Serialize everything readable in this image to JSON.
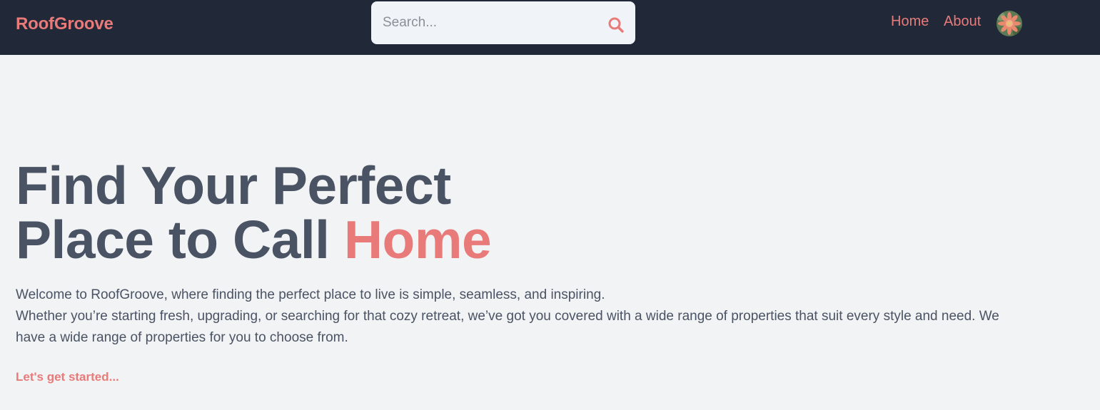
{
  "header": {
    "brand": "RoofGroove",
    "search": {
      "placeholder": "Search...",
      "value": "",
      "icon": "search-icon"
    },
    "nav": [
      {
        "label": "Home"
      },
      {
        "label": "About"
      }
    ],
    "avatar_icon": "flower-avatar-icon"
  },
  "hero": {
    "title_line1": "Find Your Perfect",
    "title_line2_prefix": "Place to Call ",
    "title_line2_accent": "Home",
    "paragraph_line1": "Welcome to RoofGroove, where finding the perfect place to live is simple, seamless, and inspiring.",
    "paragraph_line2": "Whether you’re starting fresh, upgrading, or searching for that cozy retreat, we’ve got you covered with a wide range of properties that suit every style and need. We have a wide range of properties for you to choose from.",
    "cta_label": "Let's get started..."
  },
  "colors": {
    "accent": "#e87b79",
    "navbar_bg": "#212838",
    "page_bg": "#f2f3f5",
    "heading": "#4a5363"
  }
}
